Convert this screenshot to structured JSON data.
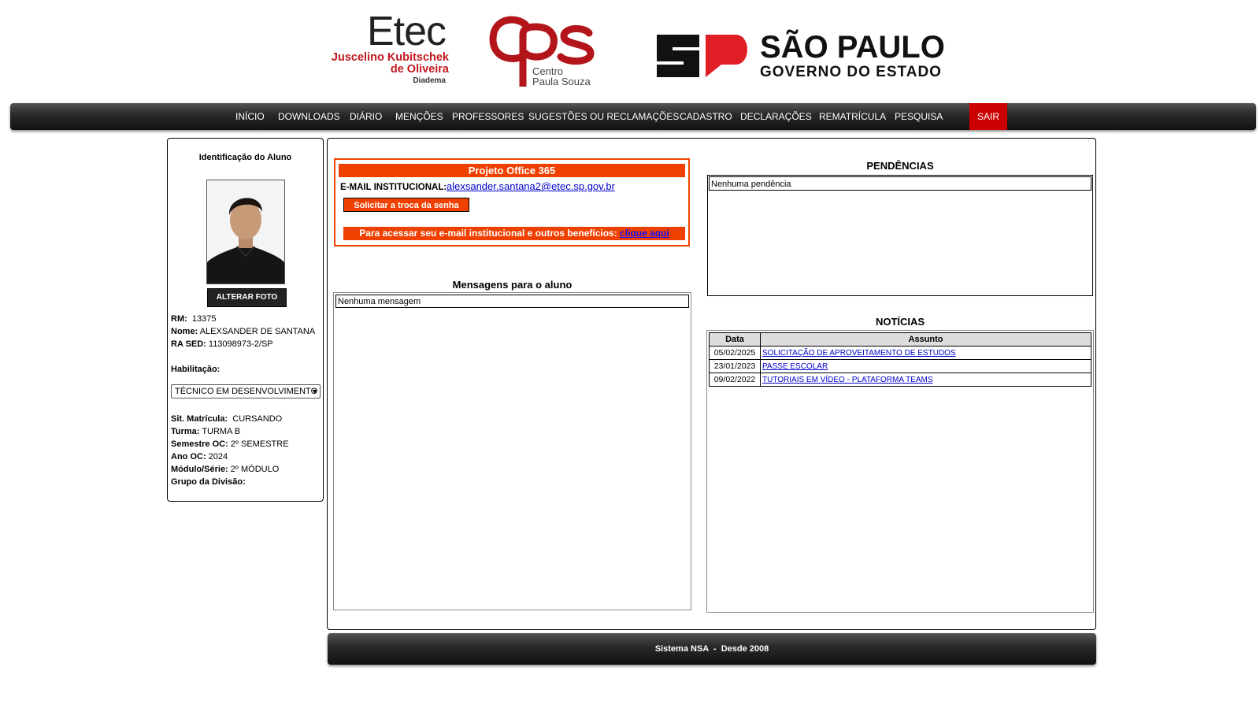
{
  "header": {
    "etec_logo": {
      "name": "Etec",
      "line1": "Juscelino Kubitschek",
      "line2": "de Oliveira",
      "city": "Diadema"
    },
    "cps_logo": {
      "mark": "cps",
      "line1": "Centro",
      "line2": "Paula Souza"
    },
    "sp_logo": {
      "title": "SÃO PAULO",
      "subtitle": "GOVERNO DO ESTADO"
    }
  },
  "nav": {
    "items": [
      "INÍCIO",
      "DOWNLOADS",
      "DIÁRIO",
      "MENÇÕES",
      "PROFESSORES",
      "SUGESTÕES OU RECLAMAÇÕES",
      "CADASTRO",
      "DECLARAÇÕES",
      "REMATRÍCULA",
      "PESQUISA"
    ],
    "logout": "SAIR"
  },
  "student": {
    "panel_title": "Identificação do Aluno",
    "photo_button": "ALTERAR FOTO",
    "rm_label": "RM:",
    "rm": "13375",
    "name_label": "Nome:",
    "name": "ALEXSANDER DE SANTANA",
    "ra_label": "RA SED:",
    "ra": "113098973-2/SP",
    "hab_label": "Habilitação:",
    "hab_value": "TÉCNICO EM DESENVOLVIMENTO",
    "sit_label": "Sit. Matrícula:",
    "sit": "CURSANDO",
    "turma_label": "Turma:",
    "turma": "TURMA B",
    "semestre_label": "Semestre OC:",
    "semestre": "2º SEMESTRE",
    "ano_label": "Ano OC:",
    "ano": "2024",
    "modulo_label": "Módulo/Série:",
    "modulo": "2º MÓDULO",
    "grupo_label": "Grupo da Divisão:"
  },
  "office365": {
    "title": "Projeto Office 365",
    "email_label": "E-MAIL INSTITUCIONAL:",
    "email": "alexsander.santana2@etec.sp.gov.br",
    "reset_button": "Solicitar a troca da senha",
    "access_text": "Para acessar seu e-mail institucional e outros benefícios:",
    "access_link": "clique aqui"
  },
  "messages": {
    "title": "Mensagens para o aluno",
    "empty": "Nenhuma mensagem"
  },
  "pendencias": {
    "title": "PENDÊNCIAS",
    "empty": "Nenhuma pendência"
  },
  "news": {
    "title": "NOTÍCIAS",
    "col_date": "Data",
    "col_subject": "Assunto",
    "rows": [
      {
        "date": "05/02/2025",
        "subject": "SOLICITAÇÃO DE APROVEITAMENTO DE ESTUDOS"
      },
      {
        "date": "23/01/2023",
        "subject": "PASSE ESCOLAR"
      },
      {
        "date": "09/02/2022",
        "subject": "TUTORIAIS EM VÍDEO - PLATAFORMA TEAMS"
      }
    ]
  },
  "footer": {
    "text": "Sistema NSA  -  Desde 2008"
  },
  "colors": {
    "orange": "#f04000",
    "logout_red": "#cc0000",
    "brand_red": "#c0181e",
    "link_blue": "#0000cc"
  }
}
